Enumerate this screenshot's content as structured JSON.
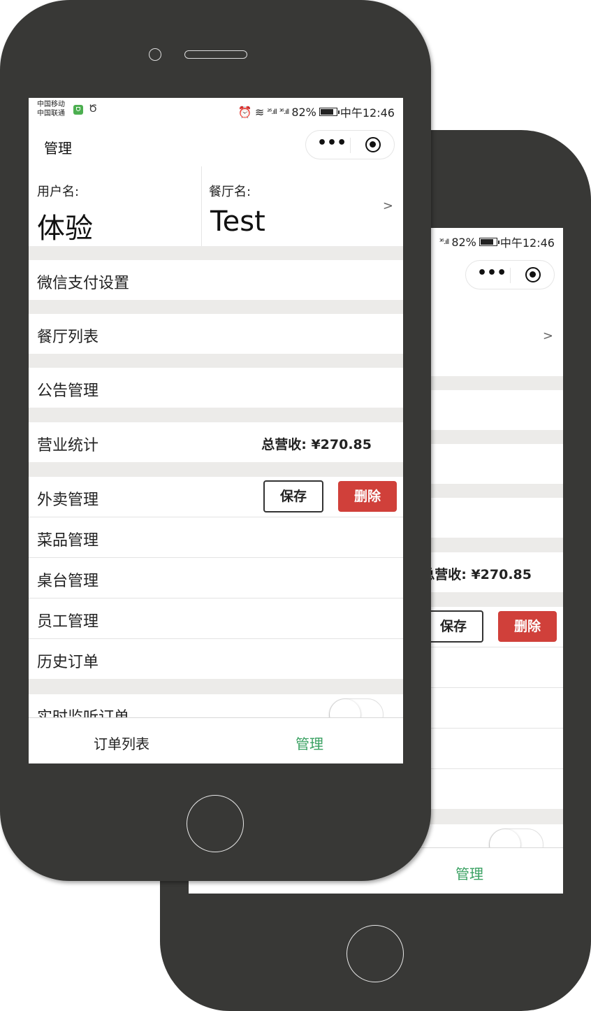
{
  "status_bar": {
    "carrier1": "中国移动",
    "carrier2": "中国联通",
    "signal1": "²⁶.ıll",
    "signal2": "³⁶.ıll",
    "battery": "82%",
    "time": "中午12:46"
  },
  "nav": {
    "title": "管理",
    "more": "•••"
  },
  "info": {
    "user_label": "用户名:",
    "user_value": "体验",
    "restaurant_label": "餐厅名:",
    "restaurant_value": "Test",
    "arrow": ">"
  },
  "menu": {
    "wechat_pay": "微信支付设置",
    "restaurant_list": "餐厅列表",
    "announcement": "公告管理",
    "business_stats": "营业统计",
    "revenue": "总营收: ¥270.85",
    "takeout": "外卖管理",
    "save": "保存",
    "delete": "删除",
    "dishes": "菜品管理",
    "tables": "桌台管理",
    "staff": "员工管理",
    "history": "历史订单",
    "realtime": "实时监听订单"
  },
  "tabbar": {
    "orders": "订单列表",
    "manage": "管理"
  },
  "colors": {
    "accent_green": "#3aa162",
    "danger_red": "#d0403a",
    "phone_body": "#383836",
    "separator": "#ecebe9"
  }
}
